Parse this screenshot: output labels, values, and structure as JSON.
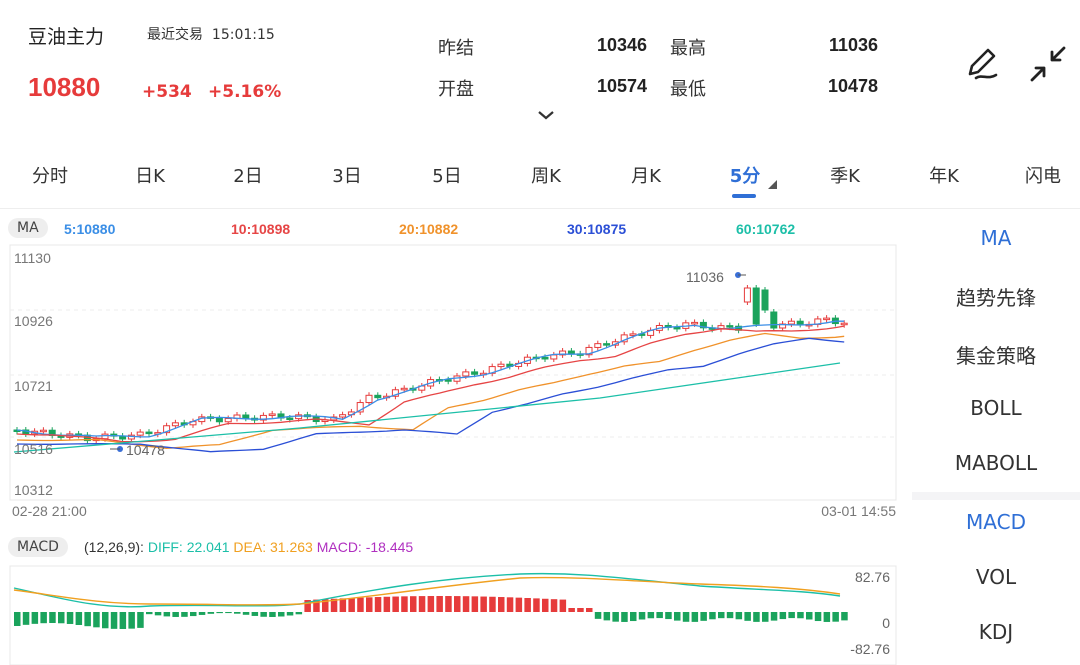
{
  "header": {
    "title": "豆油主力",
    "recent_label": "最近交易",
    "recent_time": "15:01:15",
    "price": "10880",
    "change": "+534",
    "change_pct": "+5.16%",
    "quotes": [
      {
        "label": "昨结",
        "value": "10346"
      },
      {
        "label": "最高",
        "value": "11036"
      },
      {
        "label": "开盘",
        "value": "10574"
      },
      {
        "label": "最低",
        "value": "10478"
      }
    ],
    "icons": [
      "pen-icon",
      "collapse-icon",
      "chevron-down-icon"
    ]
  },
  "tabs": [
    "分时",
    "日K",
    "2日",
    "3日",
    "5日",
    "周K",
    "月K",
    "5分",
    "季K",
    "年K",
    "闪电"
  ],
  "active_tab": "5分",
  "ma": {
    "pill": "MA",
    "items": [
      {
        "text": "5:10880",
        "color": "#3a8ee6"
      },
      {
        "text": "10:10898",
        "color": "#e64545"
      },
      {
        "text": "20:10882",
        "color": "#f0922b"
      },
      {
        "text": "30:10875",
        "color": "#2b4fd6"
      },
      {
        "text": "60:10762",
        "color": "#1cbfa8"
      }
    ]
  },
  "price_axis": [
    "11130",
    "10926",
    "10721",
    "10516",
    "10312"
  ],
  "time_axis": {
    "start": "02-28 21:00",
    "end": "03-01 14:55"
  },
  "annotations": {
    "high": "11036",
    "low": "10478"
  },
  "macd": {
    "pill": "MACD",
    "params": "(12,26,9):",
    "diff": "DIFF: 22.041",
    "dea": "DEA: 31.263",
    "macd": "MACD: -18.445",
    "diff_color": "#1cbfa8",
    "dea_color": "#f0a020",
    "macd_color": "#b030c0",
    "axis": [
      "82.76",
      "0",
      "-82.76"
    ]
  },
  "indicators": {
    "main": [
      "MA",
      "趋势先锋",
      "集金策略",
      "BOLL",
      "MABOLL"
    ],
    "sub": [
      "MACD",
      "VOL",
      "KDJ"
    ],
    "active_main": "MA",
    "active_sub": "MACD"
  },
  "colors": {
    "up": "#e63b3b",
    "down": "#1aa35c",
    "accent": "#2f6fd6"
  }
}
